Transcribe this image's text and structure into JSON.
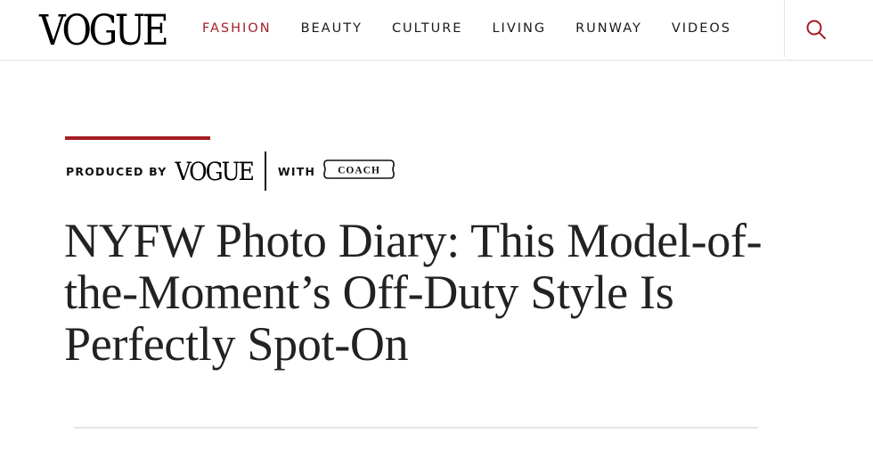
{
  "header": {
    "logo": "VOGUE",
    "nav": [
      {
        "label": "FASHION",
        "active": true
      },
      {
        "label": "BEAUTY",
        "active": false
      },
      {
        "label": "CULTURE",
        "active": false
      },
      {
        "label": "LIVING",
        "active": false
      },
      {
        "label": "RUNWAY",
        "active": false
      },
      {
        "label": "VIDEOS",
        "active": false
      }
    ],
    "search_icon": "search-icon"
  },
  "sponsor": {
    "produced_by": "PRODUCED BY",
    "producer_logo": "VOGUE",
    "with": "WITH",
    "partner_logo": "COACH"
  },
  "article": {
    "headline": "NYFW Photo Diary: This Model-of-the-Moment’s Off-Duty Style Is Perfectly Spot-On"
  },
  "colors": {
    "accent": "#a51d25",
    "text": "#1a1a1a",
    "divider": "#e3e3e3"
  }
}
